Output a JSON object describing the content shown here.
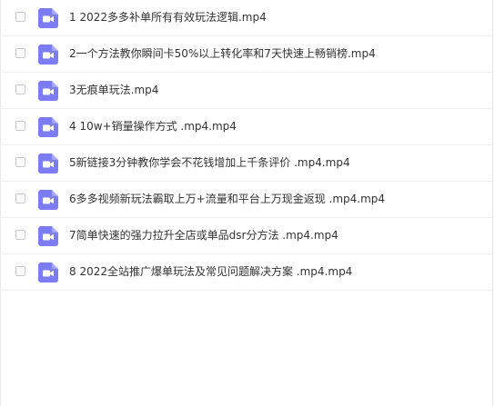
{
  "colors": {
    "icon_bg": "#7b7cf6",
    "icon_glyph": "#ffffff",
    "row_divider": "#eeeeee",
    "text": "#333333"
  },
  "file_icon_name": "video-file-icon",
  "files": [
    {
      "name": "1 2022多多补单所有有效玩法逻辑.mp4"
    },
    {
      "name": "2一个方法教你瞬间卡50%以上转化率和7天快速上畅销榜.mp4"
    },
    {
      "name": "3无痕单玩法.mp4"
    },
    {
      "name": "4 10w+销量操作方式 .mp4.mp4"
    },
    {
      "name": "5新链接3分钟教你学会不花钱增加上千条评价 .mp4.mp4"
    },
    {
      "name": "6多多视频新玩法霸取上万+流量和平台上万现金返现 .mp4.mp4"
    },
    {
      "name": "7简单快速的强力拉升全店或单品dsr分方法 .mp4.mp4"
    },
    {
      "name": "8 2022全站推广爆单玩法及常见问题解决方案 .mp4.mp4"
    }
  ]
}
